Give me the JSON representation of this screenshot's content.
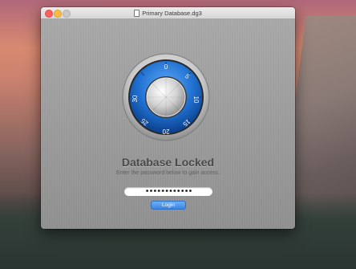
{
  "window": {
    "title": "Primary Database.dg3"
  },
  "lock": {
    "dial_numbers": [
      "0",
      "5",
      "10",
      "15",
      "20",
      "25",
      "30"
    ],
    "heading": "Database Locked",
    "subtext": "Enter the password below to gain access."
  },
  "form": {
    "password_mask": "••••••••••••",
    "login_label": "Login"
  },
  "colors": {
    "accent_blue": "#2d7fe0",
    "dial_blue": "#1f6fd0"
  }
}
